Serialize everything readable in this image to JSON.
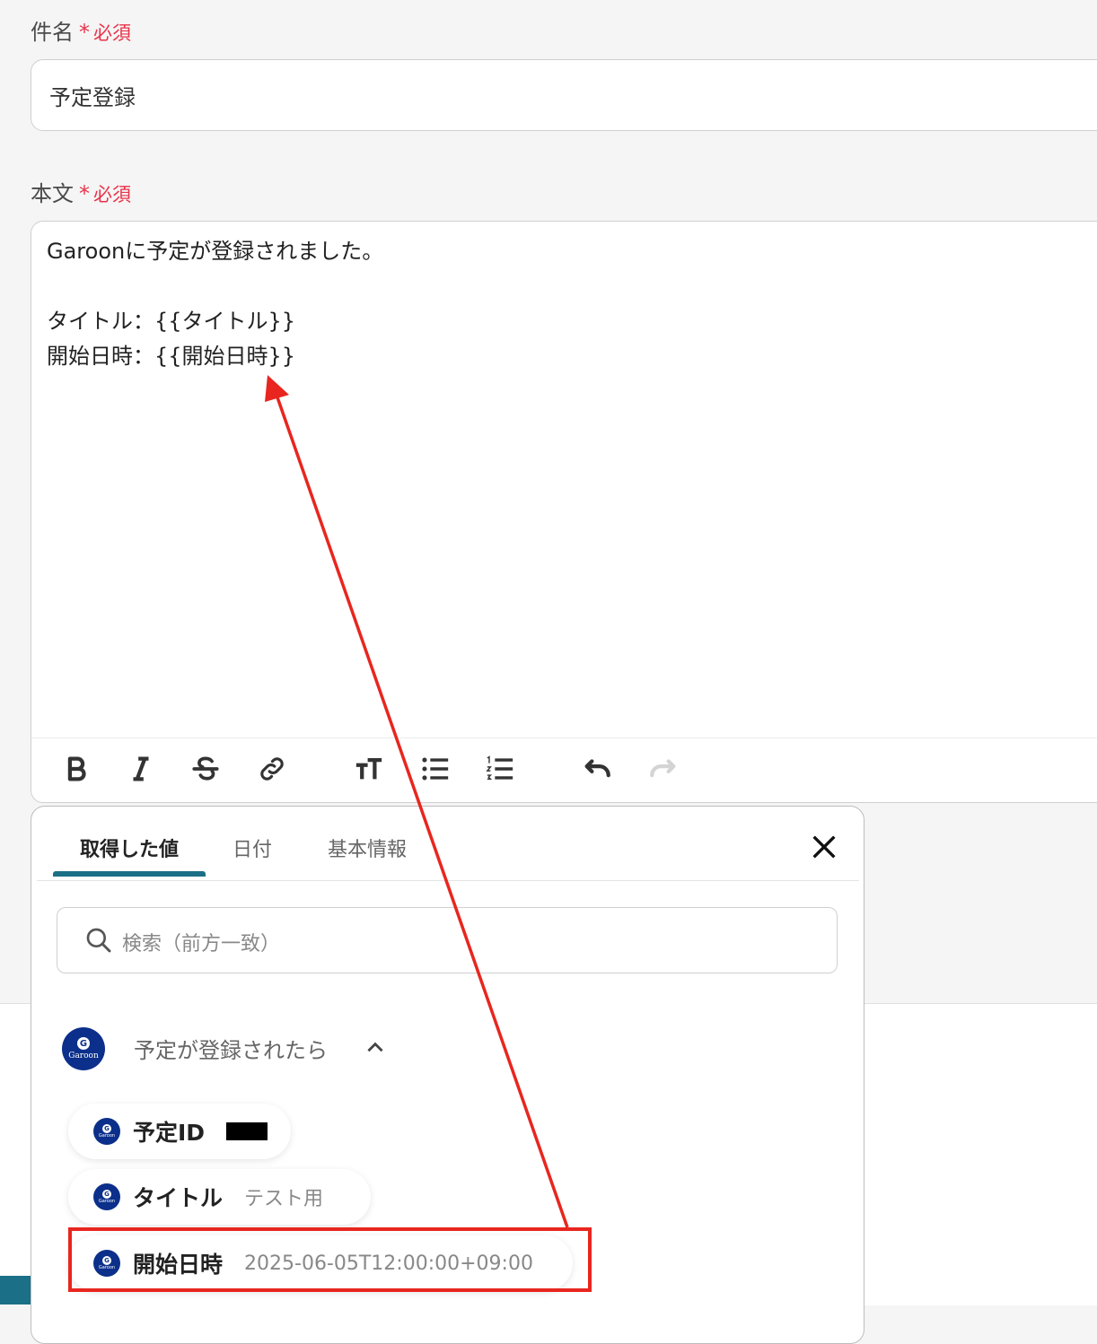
{
  "subject": {
    "label": "件名",
    "required_star": "*",
    "required_text": "必須",
    "value": "予定登録"
  },
  "body": {
    "label": "本文",
    "required_star": "*",
    "required_text": "必須",
    "lines": [
      "Garoonに予定が登録されました。",
      "",
      "タイトル：{{タイトル}}",
      "開始日時：{{開始日時}}"
    ]
  },
  "toolbar": {
    "buttons": [
      "bold-icon",
      "italic-icon",
      "strikethrough-icon",
      "link-icon",
      "text-size-icon",
      "bullet-list-icon",
      "numbered-list-icon",
      "undo-icon",
      "redo-icon"
    ]
  },
  "panel": {
    "tabs": [
      {
        "label": "取得した値",
        "active": true
      },
      {
        "label": "日付",
        "active": false
      },
      {
        "label": "基本情報",
        "active": false
      }
    ],
    "search_placeholder": "検索（前方一致）",
    "group": {
      "logo_letter": "G",
      "logo_word": "Garoon",
      "title": "予定が登録されたら",
      "items": [
        {
          "name": "予定ID",
          "value": "",
          "redacted": true
        },
        {
          "name": "タイトル",
          "value": "テスト用"
        },
        {
          "name": "開始日時",
          "value": "2025-06-05T12:00:00+09:00"
        }
      ]
    }
  },
  "colors": {
    "required": "#e8334a",
    "accent": "#1b6f86",
    "garoon": "#0b2f8a",
    "annotation": "#e8261f"
  }
}
